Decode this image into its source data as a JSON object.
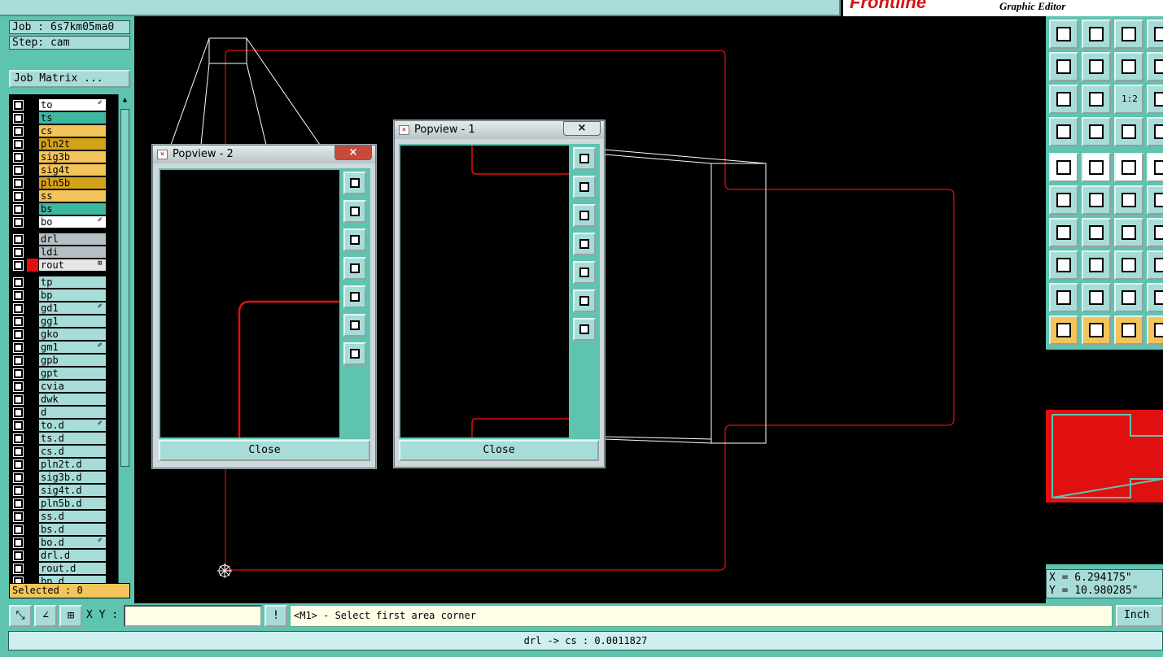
{
  "brand": {
    "logo": "Frontline",
    "subtitle": "Graphic Editor"
  },
  "job": {
    "job_text": "Job : 6s7km05ma0",
    "step_text": "Step: cam",
    "matrix_label": "Job Matrix ..."
  },
  "layers_board": [
    {
      "name": "to",
      "bg": "#ffffff",
      "icon": "brush"
    },
    {
      "name": "ts",
      "bg": "#3fb8a0",
      "icon": ""
    },
    {
      "name": "cs",
      "bg": "#f3c45a",
      "icon": ""
    },
    {
      "name": "pln2t",
      "bg": "#d4a21a",
      "icon": ""
    },
    {
      "name": "sig3b",
      "bg": "#f3c45a",
      "icon": ""
    },
    {
      "name": "sig4t",
      "bg": "#f3c45a",
      "icon": ""
    },
    {
      "name": "pln5b",
      "bg": "#d4a21a",
      "icon": ""
    },
    {
      "name": "ss",
      "bg": "#f3c45a",
      "icon": ""
    },
    {
      "name": "bs",
      "bg": "#3fb8a0",
      "icon": ""
    },
    {
      "name": "bo",
      "bg": "#ffffff",
      "icon": "brush"
    }
  ],
  "layers_drill": [
    {
      "name": "drl",
      "bg": "#b4c0c4",
      "icon": ""
    },
    {
      "name": "ldi",
      "bg": "#b4c0c4",
      "icon": ""
    },
    {
      "name": "rout",
      "bg": "#e6e6e6",
      "icon": "plus",
      "color": "#e01010",
      "active": true
    }
  ],
  "layers_misc": [
    {
      "name": "tp",
      "icon": ""
    },
    {
      "name": "bp",
      "icon": ""
    },
    {
      "name": "gd1",
      "icon": "brush"
    },
    {
      "name": "gg1",
      "icon": ""
    },
    {
      "name": "gko",
      "icon": ""
    },
    {
      "name": "gm1",
      "icon": "brush"
    },
    {
      "name": "gpb",
      "icon": ""
    },
    {
      "name": "gpt",
      "icon": ""
    },
    {
      "name": "cvia",
      "icon": ""
    },
    {
      "name": "dwk",
      "icon": ""
    },
    {
      "name": "d",
      "icon": ""
    },
    {
      "name": "to.d",
      "icon": "brush"
    },
    {
      "name": "ts.d",
      "icon": ""
    },
    {
      "name": "cs.d",
      "icon": ""
    },
    {
      "name": "pln2t.d",
      "icon": ""
    },
    {
      "name": "sig3b.d",
      "icon": ""
    },
    {
      "name": "sig4t.d",
      "icon": ""
    },
    {
      "name": "pln5b.d",
      "icon": ""
    },
    {
      "name": "ss.d",
      "icon": ""
    },
    {
      "name": "bs.d",
      "icon": ""
    },
    {
      "name": "bo.d",
      "icon": "brush"
    },
    {
      "name": "drl.d",
      "icon": ""
    },
    {
      "name": "rout.d",
      "icon": ""
    },
    {
      "name": "bp.d",
      "icon": ""
    }
  ],
  "selected_text": "Selected : 0",
  "popview2": {
    "title": "Popview - 2",
    "close_label": "Close",
    "close_icon": "×"
  },
  "popview1": {
    "title": "Popview - 1",
    "close_label": "Close",
    "close_icon": "×"
  },
  "popview_tools": [
    "zoom-window-icon",
    "pan-up-icon",
    "pan-down-icon",
    "pan-left-icon",
    "pan-right-icon",
    "zoom-home-icon",
    "zoom-fit-icon"
  ],
  "right_tools": [
    [
      "pan-up-icon",
      "pan-down-icon",
      "home-icon",
      "window-icon"
    ],
    [
      "pan-left-icon",
      "pan-right-icon",
      "undo-zoom-icon",
      "zoom-icon"
    ],
    [
      "zoom-out-icon",
      "zoom-in-icon",
      "ratio-1-2-icon",
      "help-icon"
    ],
    [
      "measure-icon",
      "snap-icon",
      "net-icon",
      "net2-icon"
    ],
    [
      "pad-icon",
      "line-icon",
      "ruler-icon",
      "select-area-icon"
    ],
    [
      "connect-icon",
      "cross-icon",
      "arc-icon",
      "move-icon"
    ],
    [
      "angle-icon",
      "slash-icon",
      "rotate-icon",
      "bracket-icon"
    ],
    [
      "resize-icon",
      "minus-icon",
      "measure-h-icon",
      "fill-icon"
    ],
    [
      "triangle-icon",
      "triangle-a-icon",
      "triangle-b-icon",
      "triangle-c-icon"
    ],
    [
      "pointer-icon",
      "pointer-red-icon",
      "pointer-circle-icon",
      "pointer-steps-icon"
    ]
  ],
  "ratio_label": "1:2",
  "coords": {
    "x": "X = 6.294175\"",
    "y": "Y = 10.980285\""
  },
  "bottom": {
    "xy_label": "X Y :",
    "xy_value": "",
    "prompt": "<M1> - Select first area corner",
    "unit": "Inch"
  },
  "status": "drl -> cs : 0.0011827",
  "colors": {
    "teal": "#5ec4b0",
    "teal_light": "#a8dcd8",
    "rout_red": "#e01010",
    "orange": "#f3c45a"
  }
}
